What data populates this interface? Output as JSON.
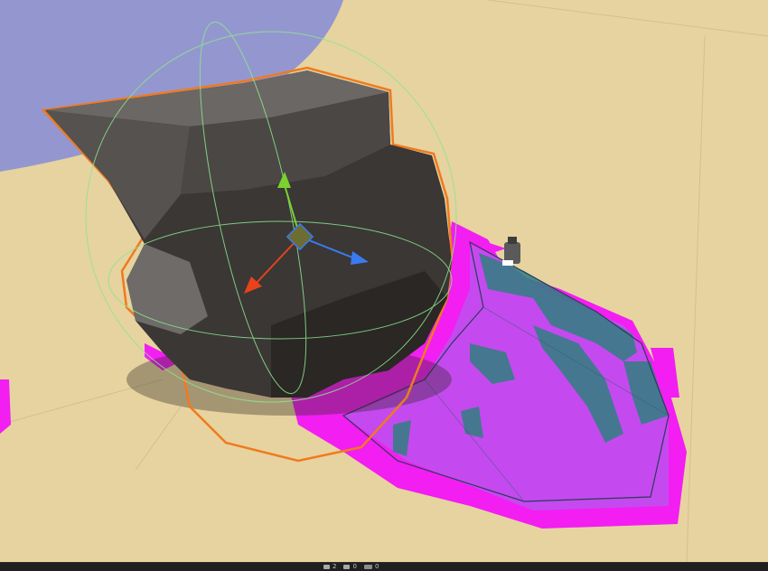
{
  "app": {
    "view": "Scene"
  },
  "statusbar": {
    "items": [
      {
        "icon": "bug-icon",
        "count": "2"
      },
      {
        "icon": "layers-icon",
        "count": "0"
      },
      {
        "icon": "tab-icon",
        "count": "0"
      }
    ]
  },
  "colors": {
    "ground": "#e6d3a0",
    "sky": "#9497cf",
    "mesh": "#3a3735",
    "selection_outline": "#f07a1e",
    "navmesh_magenta": "#f21ef2",
    "navmesh_teal": "#2f7f80",
    "gizmo_x": "#e8431b",
    "gizmo_y": "#7ad22e",
    "gizmo_z": "#3a7bf0",
    "collider_wire": "#8fe48f"
  }
}
